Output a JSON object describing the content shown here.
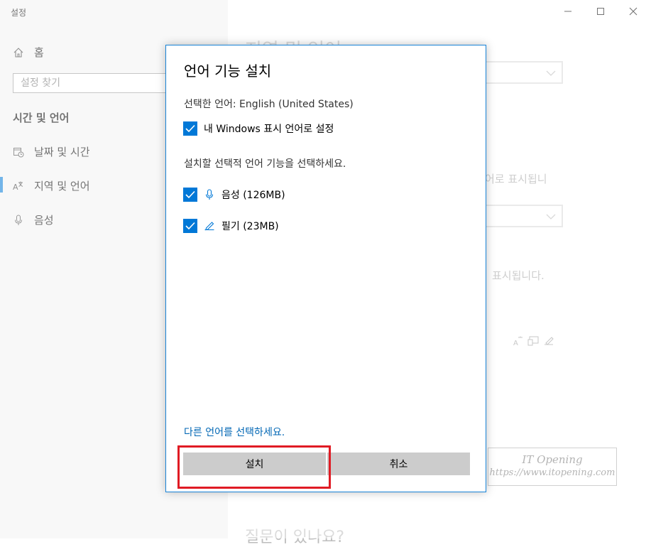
{
  "window": {
    "title": "설정"
  },
  "sidebar": {
    "home_label": "홈",
    "search_placeholder": "설정 찾기",
    "section_title": "시간 및 언어",
    "items": [
      {
        "label": "날짜 및 시간",
        "icon": "calendar-clock-icon"
      },
      {
        "label": "지역 및 언어",
        "icon": "language-icon"
      },
      {
        "label": "음성",
        "icon": "microphone-icon"
      }
    ]
  },
  "background": {
    "page_title": "지역 및 언어",
    "text_1": "어로 표시됩니",
    "text_2": "표시됩니다.",
    "footer": "질문이 있나요?",
    "watermark_title": "IT Opening",
    "watermark_url": "https://www.itopening.com"
  },
  "dialog": {
    "title": "언어 기능 설치",
    "selected_language": "선택한 언어: English (United States)",
    "display_language_option": "내 Windows 표시 언어로 설정",
    "instructions": "설치할 선택적 언어 기능을 선택하세요.",
    "features": [
      {
        "label": "음성 (126MB)",
        "icon": "microphone-icon",
        "checked": true
      },
      {
        "label": "필기 (23MB)",
        "icon": "pen-icon",
        "checked": true
      }
    ],
    "choose_other_link": "다른 언어를 선택하세요.",
    "install_button": "설치",
    "cancel_button": "취소"
  },
  "colors": {
    "accent": "#0078d7",
    "highlight": "#e01b24",
    "link": "#0066b4"
  }
}
